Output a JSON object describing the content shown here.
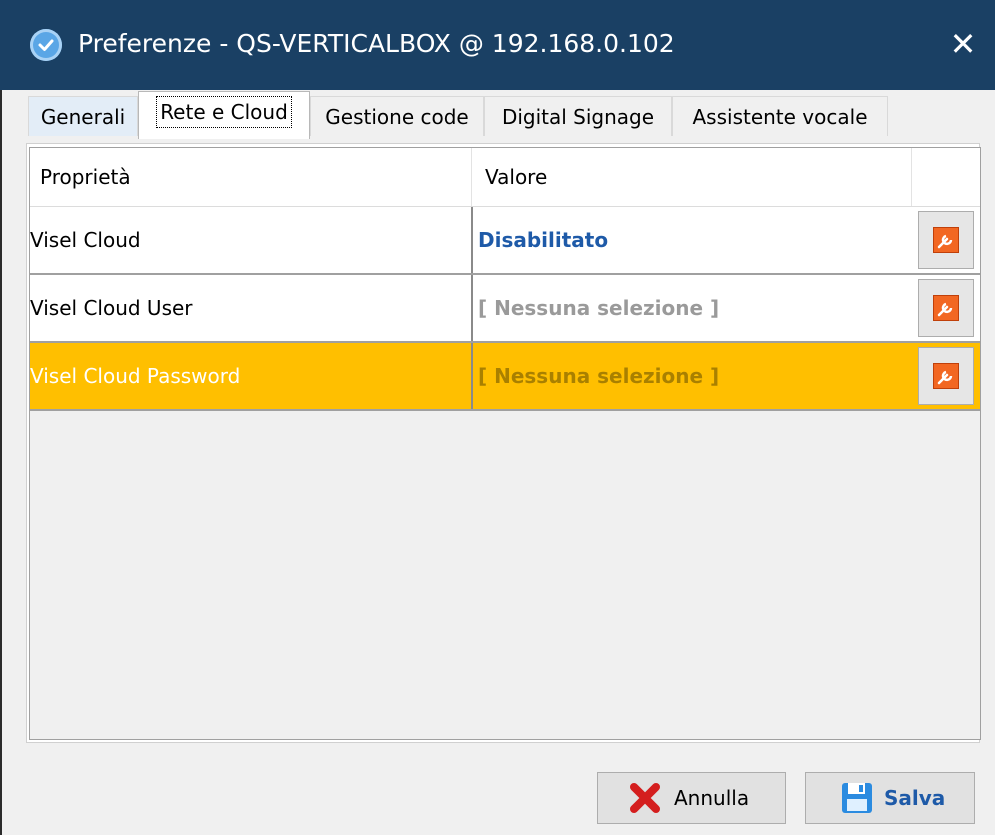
{
  "window": {
    "title": "Preferenze - QS-VERTICALBOX @ 192.168.0.102",
    "close_symbol": "✕",
    "app_icon": "app-logo-icon"
  },
  "tabs": [
    {
      "label": "Generali"
    },
    {
      "label": "Rete e Cloud",
      "active": true
    },
    {
      "label": "Gestione code"
    },
    {
      "label": "Digital Signage"
    },
    {
      "label": "Assistente vocale"
    }
  ],
  "grid": {
    "columns": [
      "Proprietà",
      "Valore",
      ""
    ],
    "rows": [
      {
        "property": "Visel Cloud",
        "value": "Disabilitato",
        "action_icon": "wrench-icon"
      },
      {
        "property": "Visel Cloud User",
        "value": "[ Nessuna selezione ]",
        "action_icon": "wrench-icon"
      },
      {
        "property": "Visel Cloud Password",
        "value": "[ Nessuna selezione ]",
        "action_icon": "wrench-icon",
        "selected": true
      }
    ]
  },
  "buttons": {
    "cancel_label": "Annulla",
    "save_label": "Salva",
    "cancel_icon": "red-x-icon",
    "save_icon": "floppy-disk-icon"
  },
  "colors": {
    "titlebar": "#1a4064",
    "selection": "#ffbf00",
    "value_blue": "#1e5aa8",
    "edit_icon_orange": "#f26722"
  }
}
